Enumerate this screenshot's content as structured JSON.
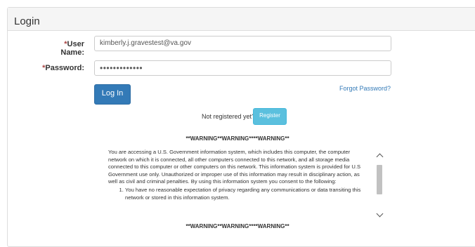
{
  "panel": {
    "title": "Login"
  },
  "form": {
    "required_marker": "*",
    "username_label": "User Name:",
    "username_value": "kimberly.j.gravestest@va.gov",
    "password_label": "Password:",
    "password_value": "•••••••••••••",
    "login_button": "Log In",
    "forgot_link": "Forgot Password?",
    "not_registered": "Not registered yet?",
    "register_button": "Register"
  },
  "warning": {
    "heading_top": "**WARNING**WARNING****WARNING**",
    "body": "You are accessing a U.S. Government information system, which includes this computer, the computer network on which it is connected, all other computers connected to this network, and all storage media connected to this computer or other computers on this network. This information system is provided for U.S Government use only. Unauthorized or improper use of this information may result in disciplinary action, as well as civil and criminal penalties. By using this information system you consent to the following:",
    "list": [
      "You have no reasonable expectation of privacy regarding any communications or data transiting this network or stored in this information system."
    ],
    "heading_bottom": "**WARNING**WARNING****WARNING**"
  },
  "icons": {
    "scroll_up": "chevron-up-icon",
    "scroll_down": "chevron-down-icon"
  }
}
